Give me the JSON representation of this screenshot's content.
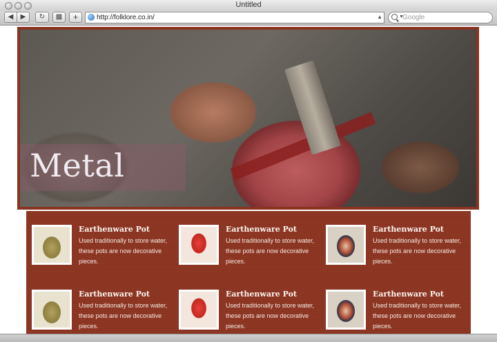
{
  "window": {
    "title": "Untitled"
  },
  "toolbar": {
    "back_icon": "arrow-left-icon",
    "forward_icon": "arrow-right-icon",
    "reload_icon": "reload-icon",
    "add_label": "+",
    "url": "http://folklore.co.in/",
    "search_placeholder": "Google"
  },
  "hero": {
    "title": "Metal"
  },
  "products": [
    {
      "title": "Earthenware Pot",
      "description": "Used traditionally to store water, these pots are now decorative pieces.",
      "image": "vase"
    },
    {
      "title": "Earthenware Pot",
      "description": "Used traditionally to store water, these pots are now decorative pieces.",
      "image": "mask-red"
    },
    {
      "title": "Earthenware Pot",
      "description": "Used traditionally to store water, these pots are now decorative pieces.",
      "image": "mask-blue"
    },
    {
      "title": "Earthenware Pot",
      "description": "Used traditionally to store water, these pots are now decorative pieces.",
      "image": "vase"
    },
    {
      "title": "Earthenware Pot",
      "description": "Used traditionally to store water, these pots are now decorative pieces.",
      "image": "mask-red"
    },
    {
      "title": "Earthenware Pot",
      "description": "Used traditionally to store water, these pots are now decorative pieces.",
      "image": "mask-blue"
    }
  ],
  "colors": {
    "accent": "#8a3320",
    "text_light": "#fdf5ef"
  }
}
